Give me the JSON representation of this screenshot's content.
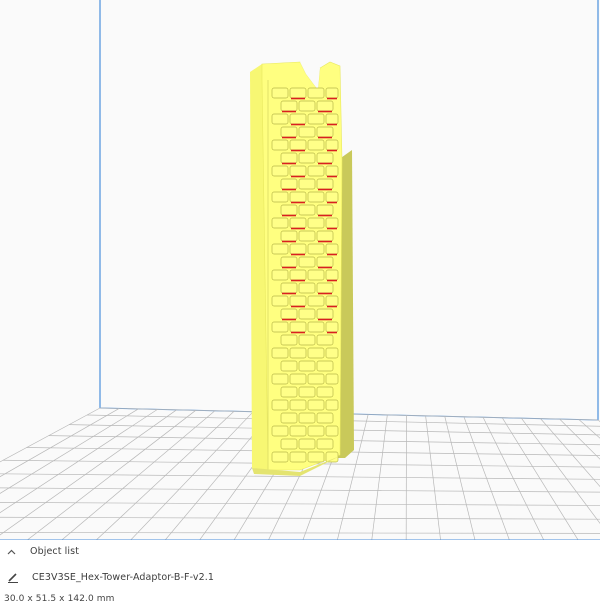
{
  "object_list": {
    "label": "Object list",
    "toggle_icon": "chevron-up-icon"
  },
  "object": {
    "name": "CE3V3SE_Hex-Tower-Adaptor-B-F-v2.1",
    "edit_icon": "pencil-icon",
    "dimensions": "30.0 x 51.5 x 142.0 mm"
  },
  "colors": {
    "model_fill": "#ffff80",
    "overhang": "#d92020",
    "build_plate_lines": "#b8b8b8",
    "volume_edge": "#4a8fdc"
  }
}
